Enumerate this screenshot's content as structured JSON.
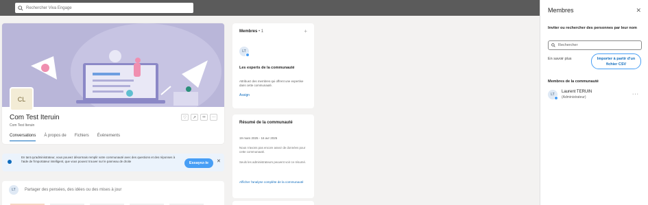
{
  "search": {
    "placeholder": "Rechercher Viva Engage"
  },
  "community": {
    "initials": "CL",
    "name": "Com Test Iteruin",
    "subtitle": "Com Test Iteruin",
    "tabs": [
      "Conversations",
      "À propos de",
      "Fichiers",
      "Événements"
    ]
  },
  "notice": {
    "text": "En tant qu'administrateur, vous pouvez désormais remplir votre communauté avec des questions et des réponses à l'aide de l'importateur intelligent, que vous pouvez trouver sur le panneau de droite",
    "try_label": "Essayez-le",
    "close": "✕"
  },
  "composer": {
    "initials": "LT",
    "placeholder": "Partager des pensées, des idées ou des mises à jour"
  },
  "members_card": {
    "title": "Membres",
    "separator": "•",
    "count": "1",
    "plus": "+",
    "initials": "LT",
    "experts_title": "Les experts de la communauté",
    "experts_desc": "Attribuez des membres qui offrent une expertise dans cette communauté.",
    "assign": "Assign"
  },
  "summary_card": {
    "title": "Résumé de la communauté",
    "date_range": "19 mars 2025 - 16 avr 2025",
    "no_data": "Nous n'avons pas encore assez de données pour cette communauté.",
    "admins_only": "Seuls les administrateurs peuvent voir ce résumé.",
    "full_analysis": "Afficher l'analyse complète de la communauté"
  },
  "panel": {
    "title": "Membres",
    "close": "✕",
    "invite_label": "Inviter ou rechercher des personnes par leur nom",
    "search_placeholder": "Rechercher",
    "learn_more": "En savoir plus",
    "import_csv": "Importer à partir d'un fichier CSV",
    "members_title": "Membres de la communauté",
    "member": {
      "initials": "LT",
      "name": "Laurent TERUIN",
      "role": "(Administrateur)",
      "more": "···"
    }
  },
  "colors": {
    "accent": "#0f6cbd",
    "banner": "#b9b6d9",
    "topbar": "#5b5b5b"
  }
}
